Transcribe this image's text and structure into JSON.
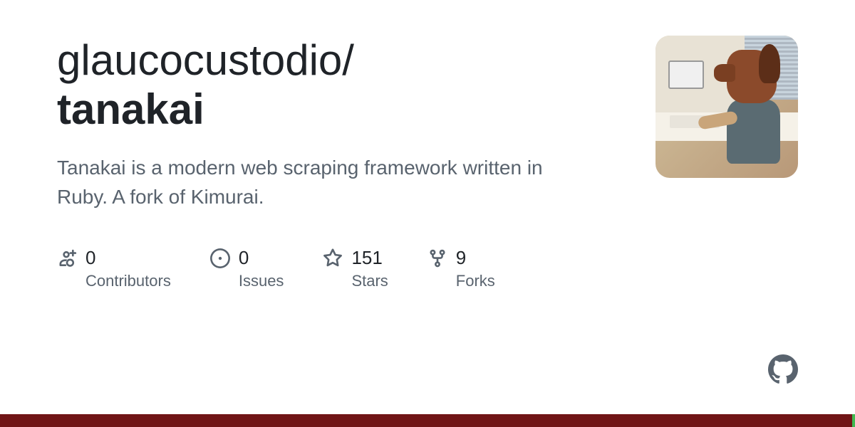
{
  "repo": {
    "owner": "glaucocustodio",
    "name": "tanakai",
    "description": "Tanakai is a modern web scraping framework written in Ruby. A fork of Kimurai."
  },
  "stats": {
    "contributors": {
      "count": "0",
      "label": "Contributors"
    },
    "issues": {
      "count": "0",
      "label": "Issues"
    },
    "stars": {
      "count": "151",
      "label": "Stars"
    },
    "forks": {
      "count": "9",
      "label": "Forks"
    }
  }
}
